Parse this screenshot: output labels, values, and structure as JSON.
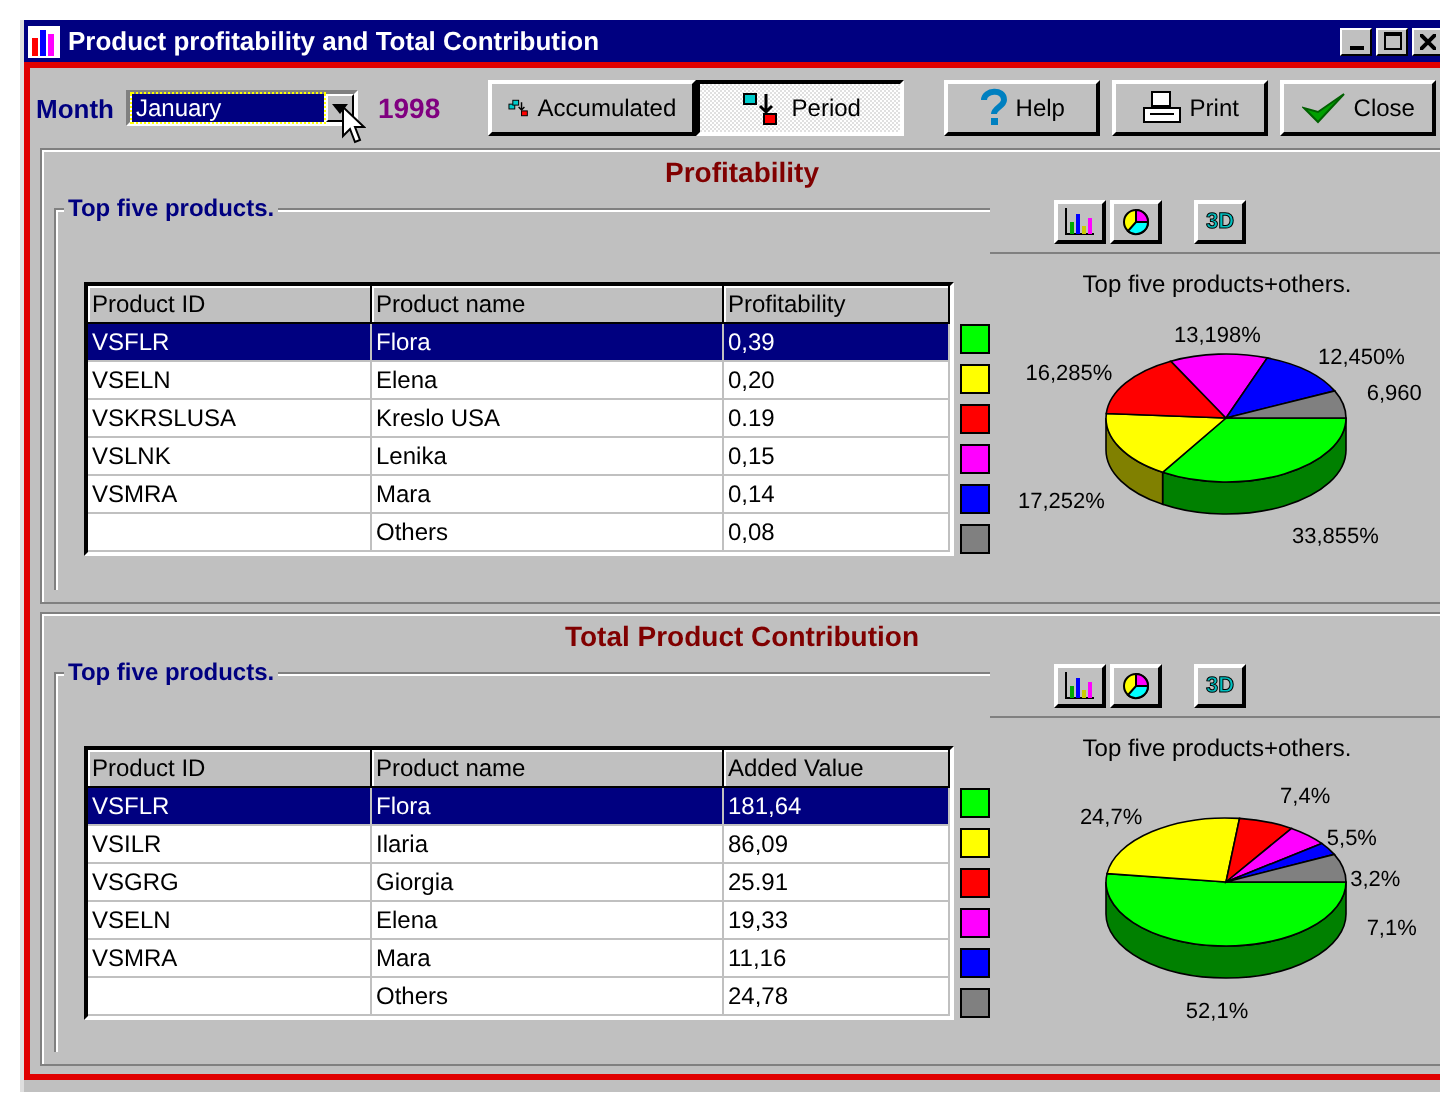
{
  "window": {
    "title": "Product profitability and Total Contribution"
  },
  "toolbar": {
    "month_label": "Month",
    "month": "January",
    "year": "1998",
    "modes": [
      {
        "kind": "accumulated",
        "label": "Accumulated",
        "selected": false
      },
      {
        "kind": "period",
        "label": "Period",
        "selected": true
      }
    ],
    "buttons": [
      {
        "kind": "help",
        "label": "Help"
      },
      {
        "kind": "print",
        "label": "Print"
      },
      {
        "kind": "close",
        "label": "Close"
      }
    ]
  },
  "panels": [
    {
      "title": "Profitability",
      "group_label": "Top five products.",
      "columns": [
        "Product ID",
        "Product name",
        "Profitability"
      ],
      "rows": [
        {
          "cells": [
            "VSFLR",
            "Flora",
            "0,39"
          ],
          "selected": true,
          "color": "#00ff00"
        },
        {
          "cells": [
            "VSELN",
            "Elena",
            "0,20"
          ],
          "selected": false,
          "color": "#ffff00"
        },
        {
          "cells": [
            "VSKRSLUSA",
            "Kreslo USA",
            "0.19"
          ],
          "selected": false,
          "color": "#ff0000"
        },
        {
          "cells": [
            "VSLNK",
            "Lenika",
            "0,15"
          ],
          "selected": false,
          "color": "#ff00ff"
        },
        {
          "cells": [
            "VSMRA",
            "Mara",
            "0,14"
          ],
          "selected": false,
          "color": "#0000ff"
        },
        {
          "cells": [
            "",
            "Others",
            "0,08"
          ],
          "selected": false,
          "color": "#808080"
        }
      ],
      "chart_buttons": [
        {
          "kind": "bar"
        },
        {
          "kind": "pie"
        },
        {
          "kind": "perspective",
          "label": "3D"
        }
      ],
      "pie": {
        "title": "Top five products+others.",
        "slice_labels": [
          "33,855%",
          "17,252%",
          "16,285%",
          "13,198%",
          "12,450%",
          "6,960"
        ]
      }
    },
    {
      "title": "Total Product Contribution",
      "group_label": "Top five products.",
      "columns": [
        "Product ID",
        "Product name",
        "Added Value"
      ],
      "rows": [
        {
          "cells": [
            "VSFLR",
            "Flora",
            "181,64"
          ],
          "selected": true,
          "color": "#00ff00"
        },
        {
          "cells": [
            "VSILR",
            "Ilaria",
            "86,09"
          ],
          "selected": false,
          "color": "#ffff00"
        },
        {
          "cells": [
            "VSGRG",
            "Giorgia",
            "25.91"
          ],
          "selected": false,
          "color": "#ff0000"
        },
        {
          "cells": [
            "VSELN",
            "Elena",
            "19,33"
          ],
          "selected": false,
          "color": "#ff00ff"
        },
        {
          "cells": [
            "VSMRA",
            "Mara",
            "11,16"
          ],
          "selected": false,
          "color": "#0000ff"
        },
        {
          "cells": [
            "",
            "Others",
            "24,78"
          ],
          "selected": false,
          "color": "#808080"
        }
      ],
      "chart_buttons": [
        {
          "kind": "bar"
        },
        {
          "kind": "pie"
        },
        {
          "kind": "perspective",
          "label": "3D"
        }
      ],
      "pie": {
        "title": "Top five products+others.",
        "slice_labels": [
          "52,1%",
          "24,7%",
          "7,4%",
          "5,5%",
          "3,2%",
          "7,1%"
        ]
      }
    }
  ]
}
